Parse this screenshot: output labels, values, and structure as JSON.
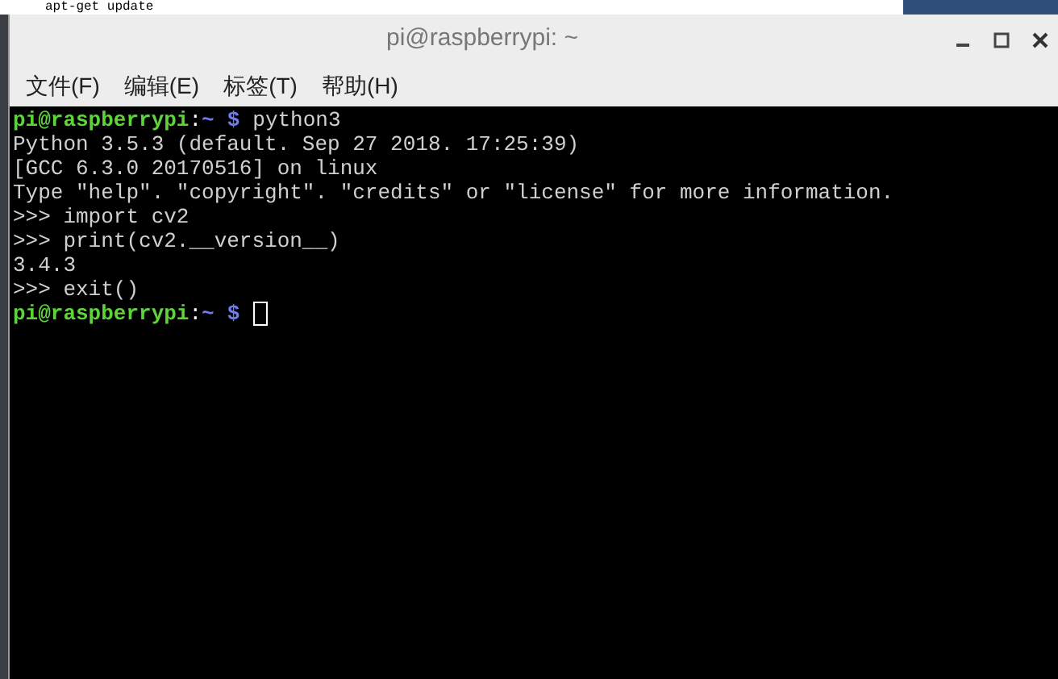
{
  "background_terminal": {
    "text": "apt-get update"
  },
  "window": {
    "title": "pi@raspberrypi: ~"
  },
  "menu": [
    {
      "label": "文件(F)"
    },
    {
      "label": "编辑(E)"
    },
    {
      "label": "标签(T)"
    },
    {
      "label": "帮助(H)"
    }
  ],
  "terminal": {
    "lines": [
      {
        "kind": "prompt",
        "host": "pi@raspberrypi",
        "separator": ":",
        "path": "~",
        "symbol": "$",
        "command": "python3",
        "cursor": false
      },
      {
        "kind": "output",
        "text": "Python 3.5.3 (default. Sep 27 2018. 17:25:39)"
      },
      {
        "kind": "output",
        "text": "[GCC 6.3.0 20170516] on linux"
      },
      {
        "kind": "output",
        "text": "Type \"help\". \"copyright\". \"credits\" or \"license\" for more information."
      },
      {
        "kind": "output",
        "text": ">>> import cv2"
      },
      {
        "kind": "output",
        "text": ">>> print(cv2.__version__)"
      },
      {
        "kind": "output",
        "text": "3.4.3"
      },
      {
        "kind": "output",
        "text": ">>> exit()"
      },
      {
        "kind": "prompt",
        "host": "pi@raspberrypi",
        "separator": ":",
        "path": "~",
        "symbol": "$",
        "cursor": true
      }
    ]
  }
}
